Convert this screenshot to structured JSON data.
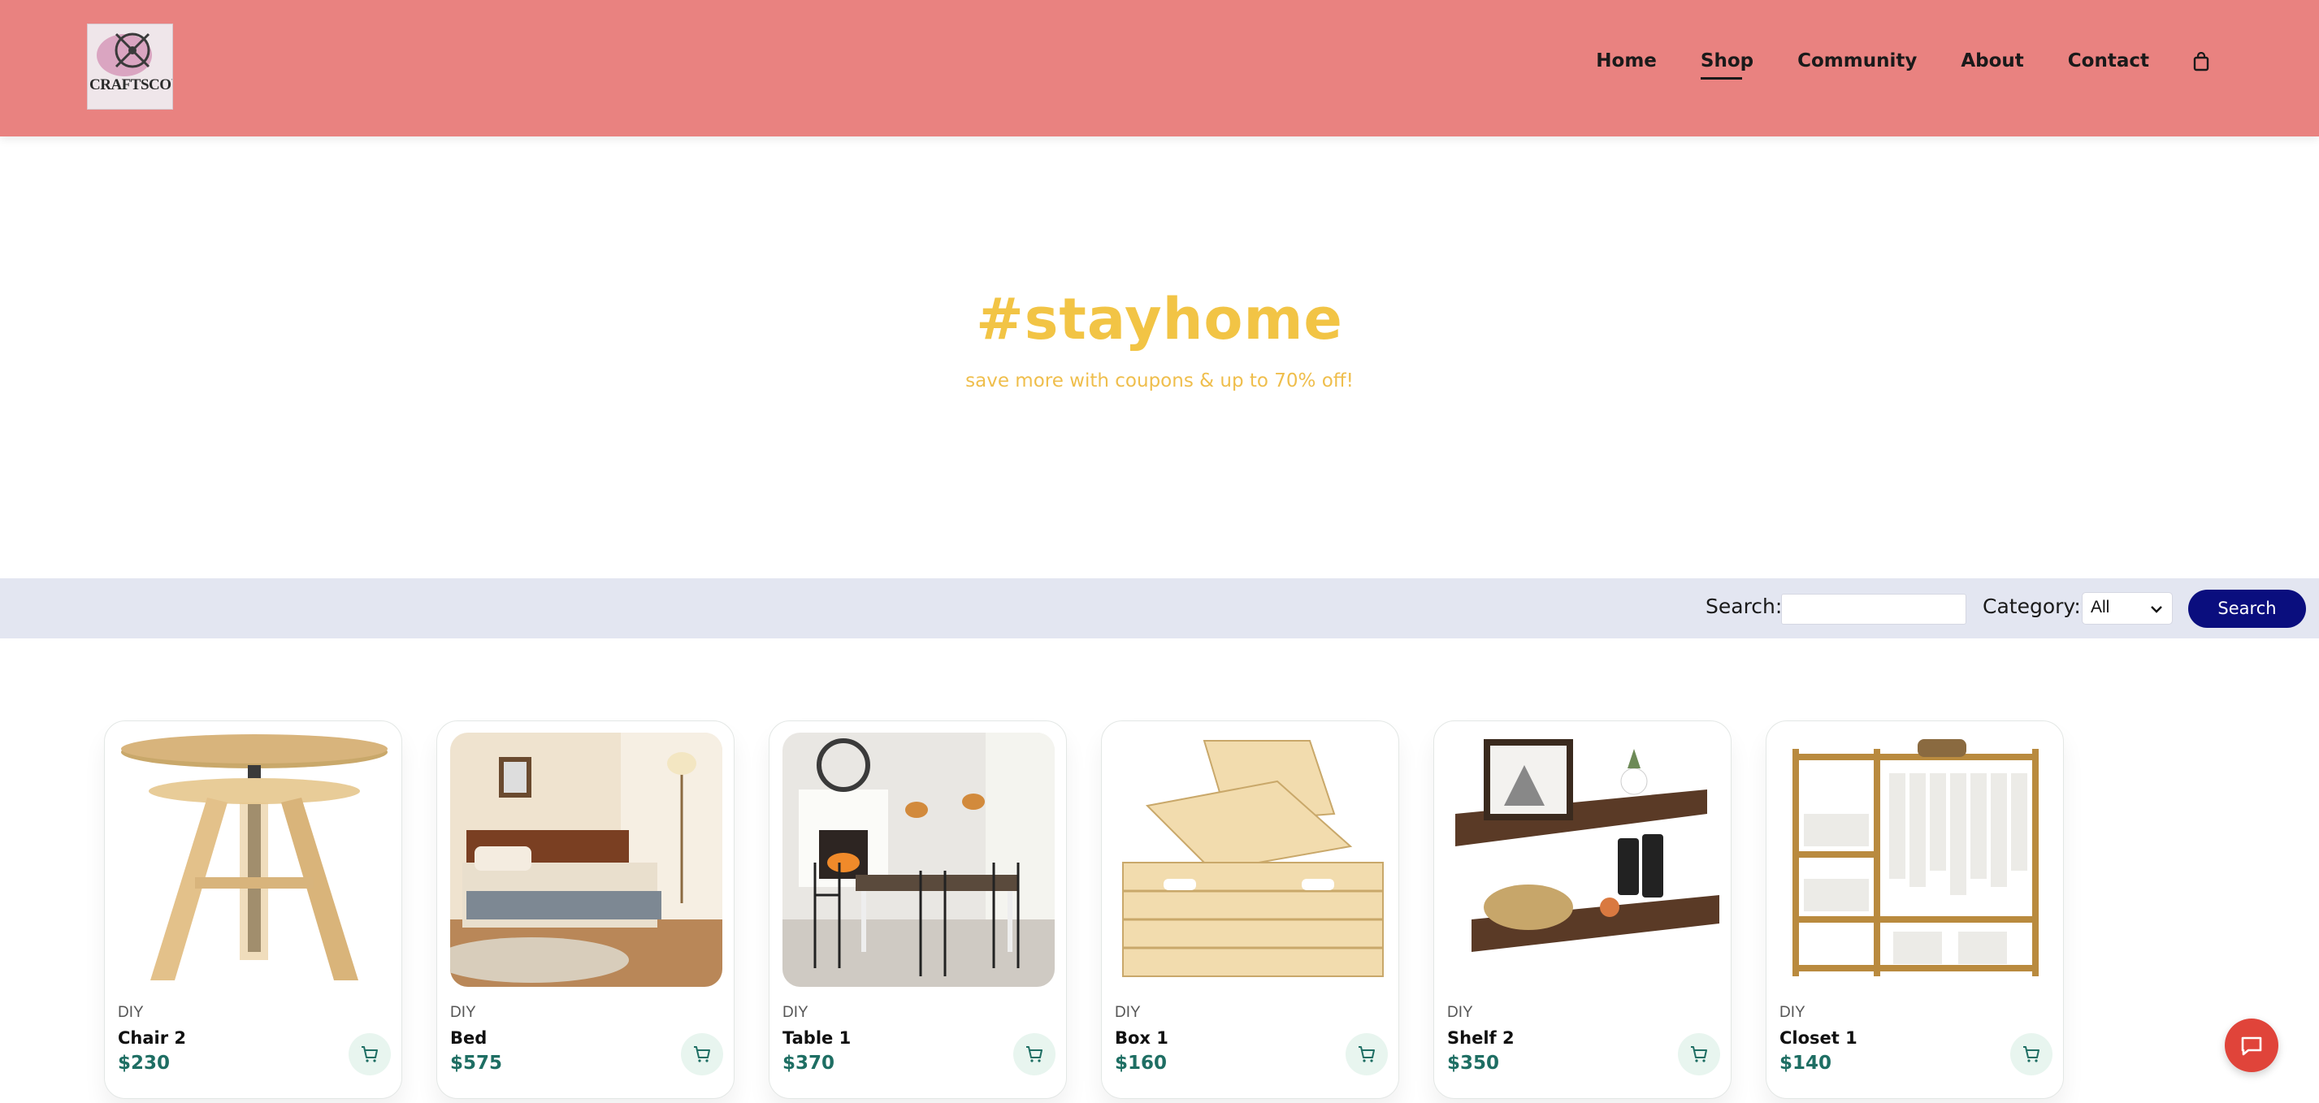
{
  "brand": {
    "logo_text": "CRAFTSCOUT"
  },
  "nav": {
    "items": [
      {
        "label": "Home",
        "active": false
      },
      {
        "label": "Shop",
        "active": true
      },
      {
        "label": "Community",
        "active": false
      },
      {
        "label": "About",
        "active": false
      },
      {
        "label": "Contact",
        "active": false
      }
    ],
    "cart_icon": "shopping-bag-icon"
  },
  "hero": {
    "title": "#stayhome",
    "subtitle": "save more with coupons & up to 70% off!"
  },
  "search": {
    "search_label": "Search:",
    "search_value": "",
    "category_label": "Category:",
    "category_value": "All",
    "button_label": "Search"
  },
  "products": [
    {
      "category": "DIY",
      "name": "Chair 2",
      "price": "$230"
    },
    {
      "category": "DIY",
      "name": "Bed",
      "price": "$575"
    },
    {
      "category": "DIY",
      "name": "Table 1",
      "price": "$370"
    },
    {
      "category": "DIY",
      "name": "Box 1",
      "price": "$160"
    },
    {
      "category": "DIY",
      "name": "Shelf 2",
      "price": "$350"
    },
    {
      "category": "DIY",
      "name": "Closet 1",
      "price": "$140"
    }
  ],
  "colors": {
    "header_bg": "#E98280",
    "hero_accent": "#F2C445",
    "search_bar_bg": "#E3E6F1",
    "search_button": "#0A0E7E",
    "price": "#1E6E63",
    "chat_button": "#E0443A"
  },
  "icons": {
    "add_to_cart": "cart-icon",
    "chat": "chat-bubble-icon"
  }
}
